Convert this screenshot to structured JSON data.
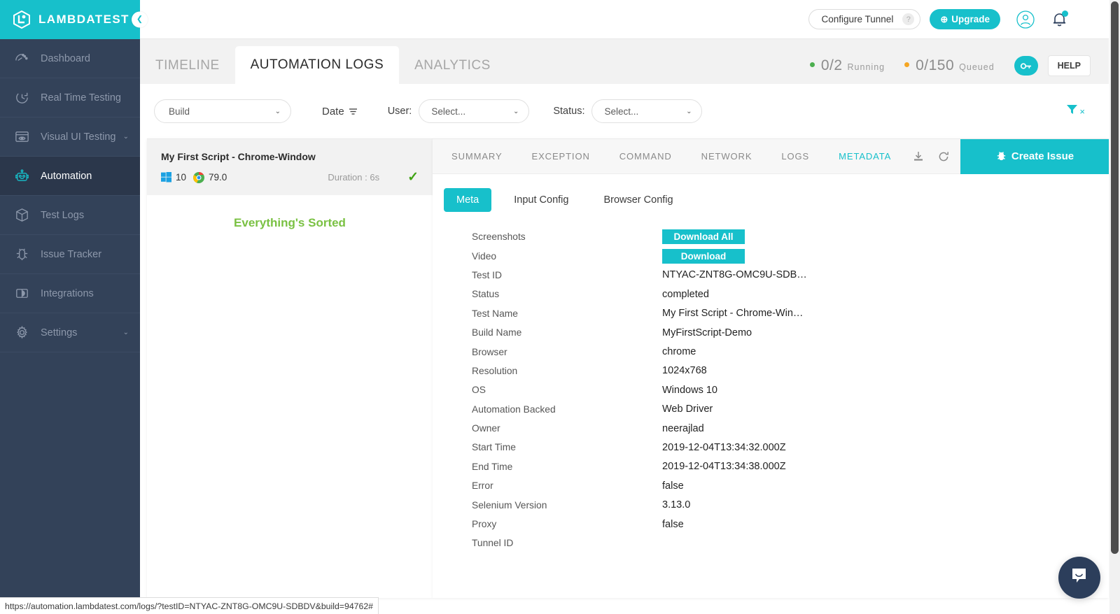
{
  "brand": {
    "name": "LAMBDATEST",
    "accent": "#17c0cb",
    "sidebar_bg": "#334259"
  },
  "sidebar": {
    "collapse_icon": "chevron-left-icon",
    "items": [
      {
        "label": "Dashboard",
        "icon": "dashboard-icon",
        "active": false,
        "caret": ""
      },
      {
        "label": "Real Time Testing",
        "icon": "clock-icon",
        "active": false,
        "caret": ""
      },
      {
        "label": "Visual UI Testing",
        "icon": "eye-window-icon",
        "active": false,
        "caret": "⌄"
      },
      {
        "label": "Automation",
        "icon": "robot-icon",
        "active": true,
        "caret": ""
      },
      {
        "label": "Test Logs",
        "icon": "box-icon",
        "active": false,
        "caret": ""
      },
      {
        "label": "Issue Tracker",
        "icon": "bug-icon",
        "active": false,
        "caret": ""
      },
      {
        "label": "Integrations",
        "icon": "puzzle-icon",
        "active": false,
        "caret": ""
      },
      {
        "label": "Settings",
        "icon": "gear-icon",
        "active": false,
        "caret": "⌄"
      }
    ]
  },
  "topbar": {
    "configure_tunnel": "Configure Tunnel",
    "help_mark": "?",
    "upgrade": "Upgrade",
    "upgrade_icon": "⊕",
    "account_icon": "user-circle-icon",
    "notification_icon": "bell-icon"
  },
  "main_tabs": [
    {
      "label": "TIMELINE",
      "active": false
    },
    {
      "label": "AUTOMATION LOGS",
      "active": true
    },
    {
      "label": "ANALYTICS",
      "active": false
    }
  ],
  "counters": [
    {
      "value": "0/2",
      "caption": "Running",
      "color": "#4caf50"
    },
    {
      "value": "0/150",
      "caption": "Queued",
      "color": "#f5a623"
    }
  ],
  "key_button_icon": "key-icon",
  "help_button": "HELP",
  "filters": {
    "build": {
      "label": "Build",
      "caret": "⌄"
    },
    "date": {
      "label": "Date",
      "icon": "sort-icon"
    },
    "user": {
      "label": "User:",
      "value": "Select...",
      "caret": "⌄"
    },
    "status": {
      "label": "Status:",
      "value": "Select...",
      "caret": "⌄"
    },
    "clear_icon": "filter-clear-icon",
    "clear_x": "×"
  },
  "test_list": {
    "card": {
      "name": "My First Script - Chrome-Window",
      "os_icon": "windows-icon",
      "os_version": "10",
      "browser_icon": "chrome-icon",
      "browser_version": "79.0",
      "duration": "Duration : 6s",
      "status_icon": "check-icon",
      "status_check": "✓"
    },
    "empty_message": "Everything's Sorted"
  },
  "detail": {
    "tabs": [
      {
        "label": "SUMMARY",
        "active": false
      },
      {
        "label": "EXCEPTION",
        "active": false
      },
      {
        "label": "COMMAND",
        "active": false
      },
      {
        "label": "NETWORK",
        "active": false
      },
      {
        "label": "LOGS",
        "active": false
      },
      {
        "label": "METADATA",
        "active": true
      }
    ],
    "download_icon": "download-icon",
    "refresh_icon": "refresh-icon",
    "create_issue": "Create Issue",
    "create_issue_icon": "bug-icon",
    "subtabs": [
      {
        "label": "Meta",
        "active": true
      },
      {
        "label": "Input Config",
        "active": false
      },
      {
        "label": "Browser Config",
        "active": false
      }
    ],
    "meta": [
      {
        "key": "Screenshots",
        "value": "Download All",
        "type": "button"
      },
      {
        "key": "Video",
        "value": "Download",
        "type": "button"
      },
      {
        "key": "Test ID",
        "value": "NTYAC-ZNT8G-OMC9U-SDB…",
        "type": "text"
      },
      {
        "key": "Status",
        "value": "completed",
        "type": "text"
      },
      {
        "key": "Test Name",
        "value": "My First Script - Chrome-Win…",
        "type": "text"
      },
      {
        "key": "Build Name",
        "value": "MyFirstScript-Demo",
        "type": "text"
      },
      {
        "key": "Browser",
        "value": "chrome",
        "type": "text"
      },
      {
        "key": "Resolution",
        "value": "1024x768",
        "type": "text"
      },
      {
        "key": "OS",
        "value": "Windows 10",
        "type": "text"
      },
      {
        "key": "Automation Backed",
        "value": "Web Driver",
        "type": "text"
      },
      {
        "key": "Owner",
        "value": "neerajlad",
        "type": "text"
      },
      {
        "key": "Start Time",
        "value": "2019-12-04T13:34:32.000Z",
        "type": "text"
      },
      {
        "key": "End Time",
        "value": "2019-12-04T13:34:38.000Z",
        "type": "text"
      },
      {
        "key": "Error",
        "value": "false",
        "type": "text"
      },
      {
        "key": "Selenium Version",
        "value": "3.13.0",
        "type": "text"
      },
      {
        "key": "Proxy",
        "value": "false",
        "type": "text"
      },
      {
        "key": "Tunnel ID",
        "value": "",
        "type": "text"
      }
    ]
  },
  "chat_widget_icon": "chat-bubble-icon",
  "status_bar_url": "https://automation.lambdatest.com/logs/?testID=NTYAC-ZNT8G-OMC9U-SDBDV&build=94762#"
}
